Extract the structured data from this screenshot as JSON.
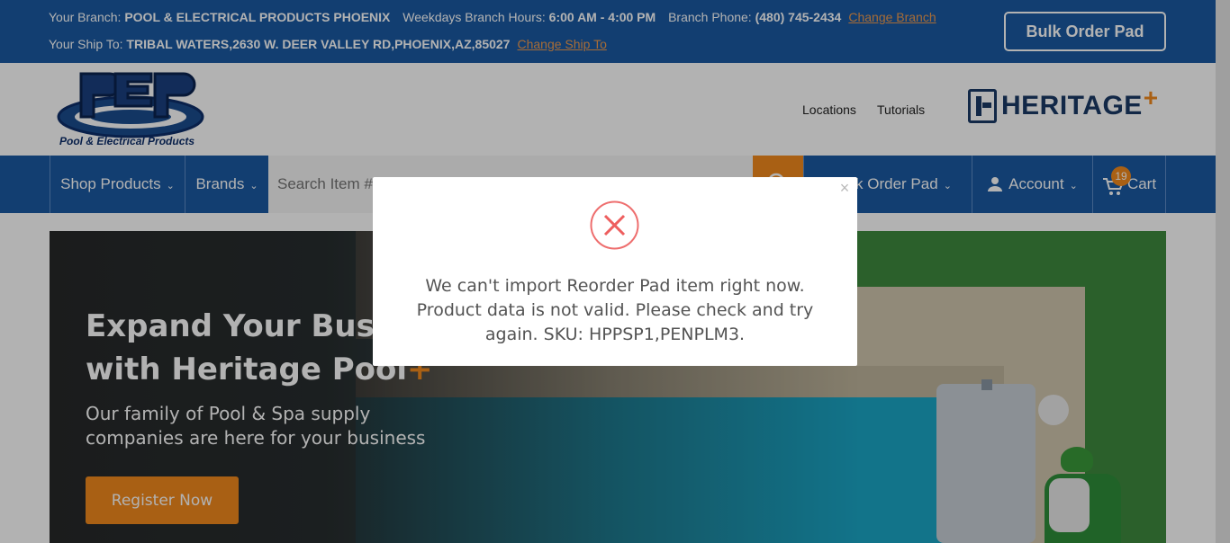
{
  "topbar": {
    "branch_label": "Your Branch:",
    "branch_name": "POOL & ELECTRICAL PRODUCTS PHOENIX",
    "hours_label": "Weekdays Branch Hours:",
    "hours_value": "6:00 AM - 4:00 PM",
    "phone_label": "Branch Phone:",
    "phone_value": "(480) 745-2434",
    "change_branch_link": "Change Branch",
    "shipto_label": "Your Ship To:",
    "shipto_value": "TRIBAL WATERS,2630 W. DEER VALLEY RD,PHOENIX,AZ,85027",
    "change_shipto_link": "Change Ship To",
    "bulk_order_button": "Bulk Order Pad"
  },
  "header": {
    "logo_subtitle": "Pool & Electrical Products",
    "links": [
      "Locations",
      "Tutorials"
    ],
    "heritage_logo": "HERITAGE",
    "heritage_plus": "+"
  },
  "nav": {
    "shop_products": "Shop Products",
    "brands": "Brands",
    "search_placeholder": "Search Item #, Brand, Description",
    "quick_order_pad": "Quick Order Pad",
    "account": "Account",
    "cart": "Cart",
    "cart_count": "19"
  },
  "hero": {
    "title_line1": "Expand Your Business",
    "title_line2": "with Heritage Pool",
    "title_plus": "+",
    "subtitle": "Our family of Pool & Spa supply companies  are here for your business",
    "register_button": "Register Now"
  },
  "modal": {
    "close_glyph": "×",
    "icon": "error-x-icon",
    "message": "We can't import Reorder Pad item right now. Product data is not valid. Please check and try again. SKU: HPPSP1,PENPLM3."
  },
  "colors": {
    "brand_blue": "#1a5aa3",
    "accent_orange": "#f28a1e",
    "error_red": "#ee6e6e"
  }
}
